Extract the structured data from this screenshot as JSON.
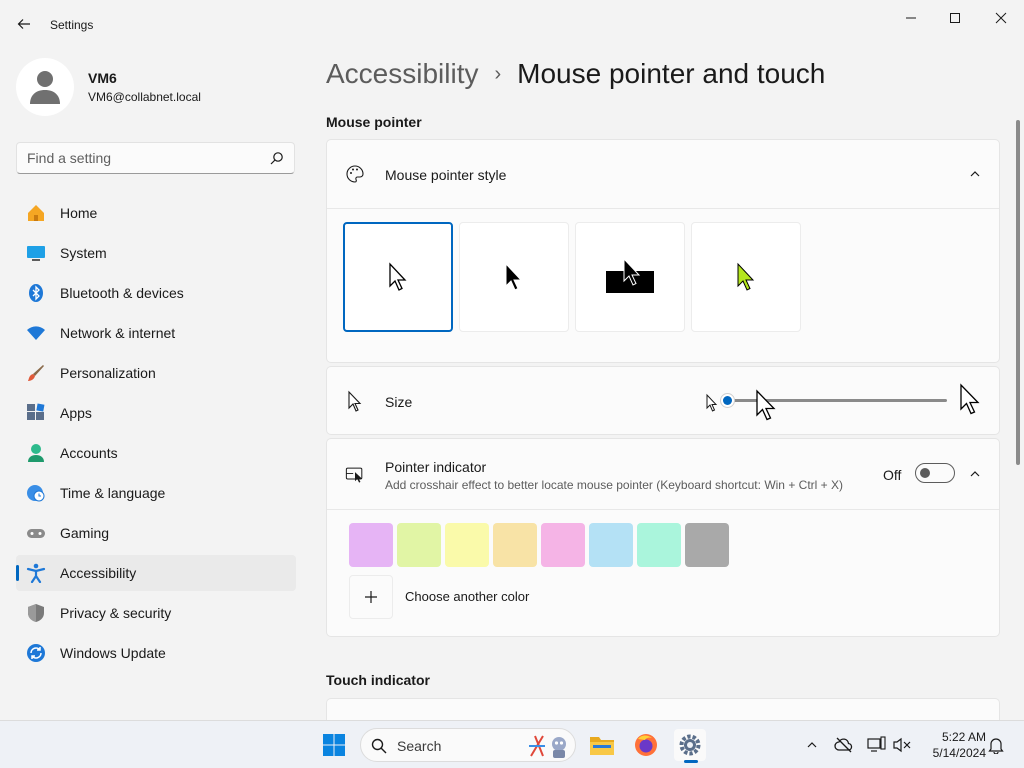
{
  "window": {
    "title": "Settings"
  },
  "profile": {
    "name": "VM6",
    "email": "VM6@collabnet.local"
  },
  "search": {
    "placeholder": "Find a setting"
  },
  "sidebar": {
    "items": [
      {
        "label": "Home",
        "icon": "home-icon"
      },
      {
        "label": "System",
        "icon": "monitor-icon"
      },
      {
        "label": "Bluetooth & devices",
        "icon": "bluetooth-icon"
      },
      {
        "label": "Network & internet",
        "icon": "wifi-icon"
      },
      {
        "label": "Personalization",
        "icon": "brush-icon"
      },
      {
        "label": "Apps",
        "icon": "apps-icon"
      },
      {
        "label": "Accounts",
        "icon": "person-icon"
      },
      {
        "label": "Time & language",
        "icon": "globe-clock-icon"
      },
      {
        "label": "Gaming",
        "icon": "gamepad-icon"
      },
      {
        "label": "Accessibility",
        "icon": "accessibility-icon"
      },
      {
        "label": "Privacy & security",
        "icon": "shield-icon"
      },
      {
        "label": "Windows Update",
        "icon": "update-icon"
      }
    ],
    "active_index": 9
  },
  "breadcrumb": {
    "parent": "Accessibility",
    "separator": "›",
    "current": "Mouse pointer and touch"
  },
  "mouse_pointer": {
    "section_title": "Mouse pointer",
    "style": {
      "label": "Mouse pointer style",
      "selected_index": 0,
      "options": [
        "white-pointer",
        "black-pointer",
        "inverted-pointer",
        "custom-pointer"
      ],
      "custom_color": "#b4e61e"
    },
    "size": {
      "label": "Size",
      "value": 1,
      "min": 1,
      "max": 15
    },
    "indicator": {
      "label": "Pointer indicator",
      "description": "Add crosshair effect to better locate mouse pointer (Keyboard shortcut: Win + Ctrl + X)",
      "state": "Off",
      "colors": [
        "#e6b4f5",
        "#e1f5a5",
        "#fafaaa",
        "#f8e3a6",
        "#f5b4e6",
        "#b4e1f5",
        "#aaf5dc",
        "#a9a9a9"
      ],
      "add_color_label": "Choose another color"
    }
  },
  "touch": {
    "section_title": "Touch indicator"
  },
  "taskbar": {
    "search_label": "Search",
    "time": "5:22 AM",
    "date": "5/14/2024"
  }
}
